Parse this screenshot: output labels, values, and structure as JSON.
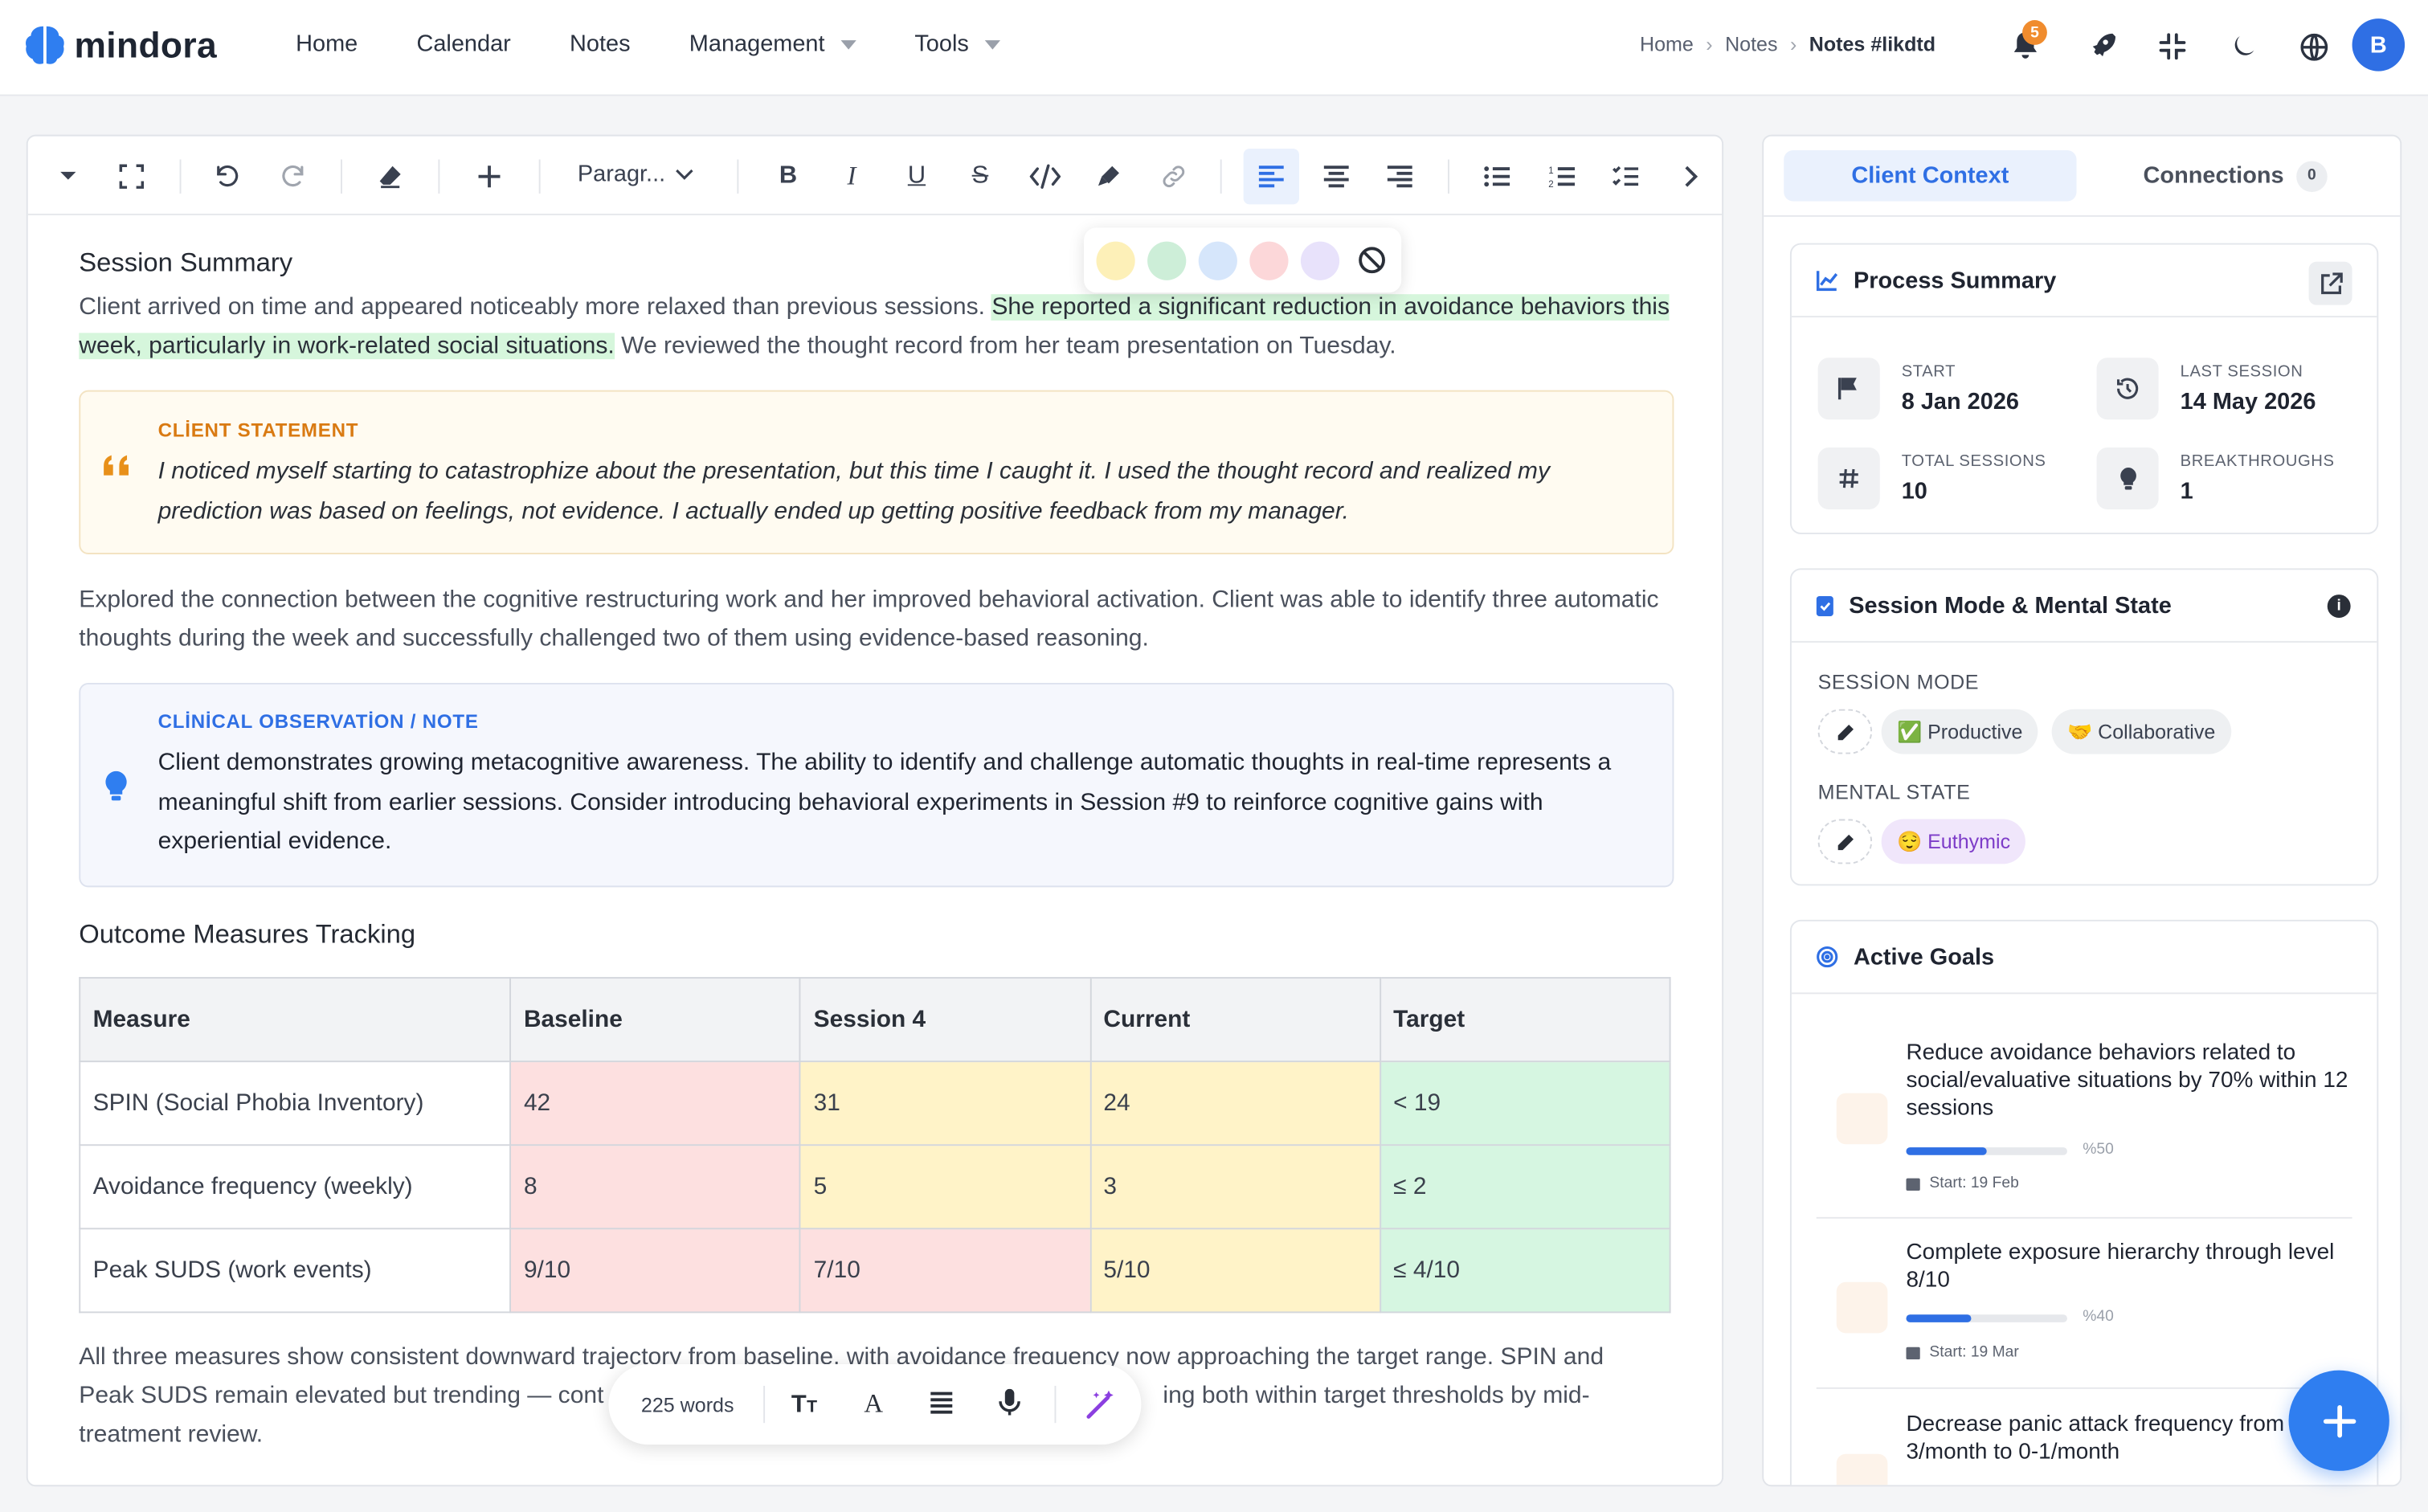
{
  "app": {
    "name": "mindora"
  },
  "nav": {
    "home": "Home",
    "calendar": "Calendar",
    "notes": "Notes",
    "management": "Management",
    "tools": "Tools"
  },
  "breadcrumb": {
    "home": "Home",
    "notes": "Notes",
    "current": "Notes #likdtd"
  },
  "header": {
    "notification_count": "5",
    "avatar_initial": "B"
  },
  "toolbar": {
    "paragraph_select": "Paragr..."
  },
  "highlight_colors": [
    "#fdf0b8",
    "#cdeed8",
    "#d6e6fb",
    "#fcd7d9",
    "#e8e2fb"
  ],
  "doc": {
    "h_summary": "Session Summary",
    "p1_a": "Client arrived on time and appeared noticeably more relaxed than previous sessions. ",
    "p1_hl": "She reported a significant reduction in avoidance behaviors this week, particularly in work-related social situations.",
    "p1_b": " We reviewed the thought record from her team presentation on Tuesday.",
    "client_statement_title": "CLİENT STATEMENT",
    "client_statement": "I noticed myself starting to catastrophize about the presentation, but this time I caught it. I used the thought record and realized my prediction was based on feelings, not evidence. I actually ended up getting positive feedback from my manager.",
    "p2": "Explored the connection between the cognitive restructuring work and her improved behavioral activation. Client was able to identify three automatic thoughts during the week and successfully challenged two of them using evidence-based reasoning.",
    "observation_title": "CLİNİCAL OBSERVATİON / NOTE",
    "observation": "Client demonstrates growing metacognitive awareness. The ability to identify and challenge automatic thoughts in real-time represents a meaningful shift from earlier sessions. Consider introducing behavioral experiments in Session #9 to reinforce cognitive gains with experiential evidence.",
    "h_outcome": "Outcome Measures Tracking",
    "table": {
      "headers": [
        "Measure",
        "Baseline",
        "Session 4",
        "Current",
        "Target"
      ],
      "rows": [
        [
          "SPIN (Social Phobia Inventory)",
          "42",
          "31",
          "24",
          "< 19"
        ],
        [
          "Avoidance frequency (weekly)",
          "8",
          "5",
          "3",
          "≤ 2"
        ],
        [
          "Peak SUDS (work events)",
          "9/10",
          "7/10",
          "5/10",
          "≤ 4/10"
        ]
      ]
    },
    "p3_l1": "All three measures show consistent downward trajectory from baseline, with avoidance frequency now approaching the target range. SPIN and",
    "p3_l2a": "Peak SUDS remain elevated but trending — cont",
    "p3_l2b": "ing both within target thresholds by mid-",
    "p3_l3": "treatment review."
  },
  "wordbar": {
    "count": "225 words"
  },
  "right": {
    "tab_context": "Client Context",
    "tab_connections": "Connections",
    "connections_count": "0",
    "process": {
      "title": "Process Summary",
      "start_label": "START",
      "start": "8 Jan 2026",
      "last_label": "LAST SESSION",
      "last": "14 May 2026",
      "total_label": "TOTAL SESSIONS",
      "total": "10",
      "break_label": "BREAKTHROUGHS",
      "breaks": "1"
    },
    "mode": {
      "title": "Session Mode & Mental State",
      "session_mode_label": "SESSİON MODE",
      "chip_productive": "✅ Productive",
      "chip_collaborative": "🤝 Collaborative",
      "mental_state_label": "MENTAL STATE",
      "chip_euthymic": "😌 Euthymic"
    },
    "goals": {
      "title": "Active Goals",
      "items": [
        {
          "text": "Reduce avoidance behaviors related to social/evaluative situations by 70% within 12 sessions",
          "progress": 0.5,
          "pct": "%50",
          "date": "Start: 19 Feb"
        },
        {
          "text": "Complete exposure hierarchy through level 8/10",
          "progress": 0.4,
          "pct": "%40",
          "date": "Start: 19 Mar"
        },
        {
          "text": "Decrease panic attack frequency from 2-3/month to 0-1/month"
        }
      ]
    }
  }
}
